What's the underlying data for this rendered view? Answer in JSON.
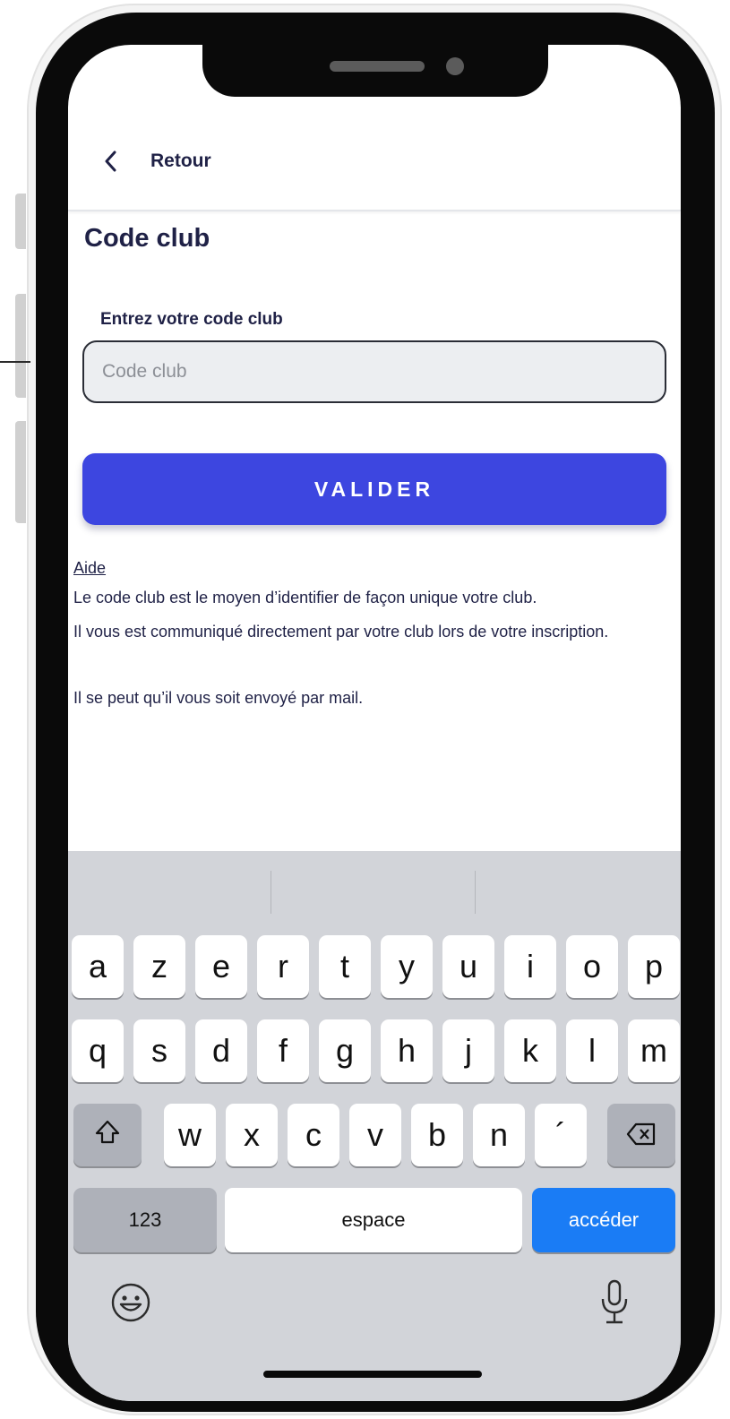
{
  "nav": {
    "back_label": "Retour",
    "back_icon": "chevron-left-icon"
  },
  "page": {
    "title": "Code club",
    "field_label": "Entrez votre code club",
    "input_placeholder": "Code club",
    "input_value": "",
    "button_label": "VALIDER"
  },
  "help": {
    "link": "Aide",
    "paragraphs": [
      "Le code club est le moyen d’identifier de façon unique votre club.",
      "Il vous est communiqué directement par votre club lors de votre inscription.",
      "Il se peut qu’il vous soit envoyé par mail."
    ]
  },
  "keyboard": {
    "row1": [
      "a",
      "z",
      "e",
      "r",
      "t",
      "y",
      "u",
      "i",
      "o",
      "p"
    ],
    "row2": [
      "q",
      "s",
      "d",
      "f",
      "g",
      "h",
      "j",
      "k",
      "l",
      "m"
    ],
    "row3": [
      "w",
      "x",
      "c",
      "v",
      "b",
      "n",
      "´"
    ],
    "numbers_key": "123",
    "space_key": "espace",
    "go_key": "accéder",
    "shift_icon": "shift-icon",
    "delete_icon": "backspace-icon",
    "emoji_icon": "emoji-icon",
    "mic_icon": "microphone-icon"
  },
  "colors": {
    "primary": "#3d46e0",
    "text": "#1f2146",
    "go_key": "#1a7cf5"
  }
}
